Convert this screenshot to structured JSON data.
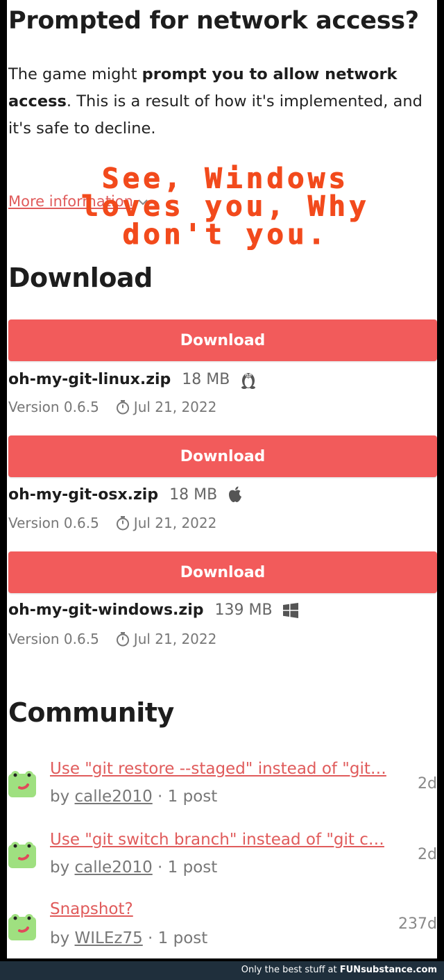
{
  "network": {
    "heading": "Prompted for network access?",
    "intro_pre": "The game might ",
    "intro_bold": "prompt you to allow network access",
    "intro_post": ". This is a result of how it's implemented, and it's safe to decline.",
    "more_info": "More information"
  },
  "meme_overlay": {
    "lines": [
      "See, Windows",
      "loves you, Why",
      "don't you."
    ],
    "color": "#f24a1c"
  },
  "download": {
    "heading": "Download",
    "button_label": "Download",
    "button_color": "#f25b5b",
    "files": [
      {
        "name": "oh-my-git-linux.zip",
        "size": "18 MB",
        "icon": "linux-tux-icon",
        "version": "Version 0.6.5",
        "date": "Jul 21, 2022"
      },
      {
        "name": "oh-my-git-osx.zip",
        "size": "18 MB",
        "icon": "apple-icon",
        "version": "Version 0.6.5",
        "date": "Jul 21, 2022"
      },
      {
        "name": "oh-my-git-windows.zip",
        "size": "139 MB",
        "icon": "windows-icon",
        "version": "Version 0.6.5",
        "date": "Jul 21, 2022"
      }
    ]
  },
  "community": {
    "heading": "Community",
    "topics": [
      {
        "title": "Use \"git restore --staged\" instead of \"git…",
        "by": "by ",
        "user": "calle2010",
        "posts": " · 1 post",
        "age": "2d"
      },
      {
        "title": "Use \"git switch branch\" instead of \"git c…",
        "by": "by ",
        "user": "calle2010",
        "posts": " · 1 post",
        "age": "2d"
      },
      {
        "title": "Snapshot?",
        "by": "by ",
        "user": "WILEz75",
        "posts": " · 1 post",
        "age": "237d"
      }
    ]
  },
  "footer": {
    "text": "Only the best stuff at ",
    "brand": "FUNsubstance.com"
  }
}
